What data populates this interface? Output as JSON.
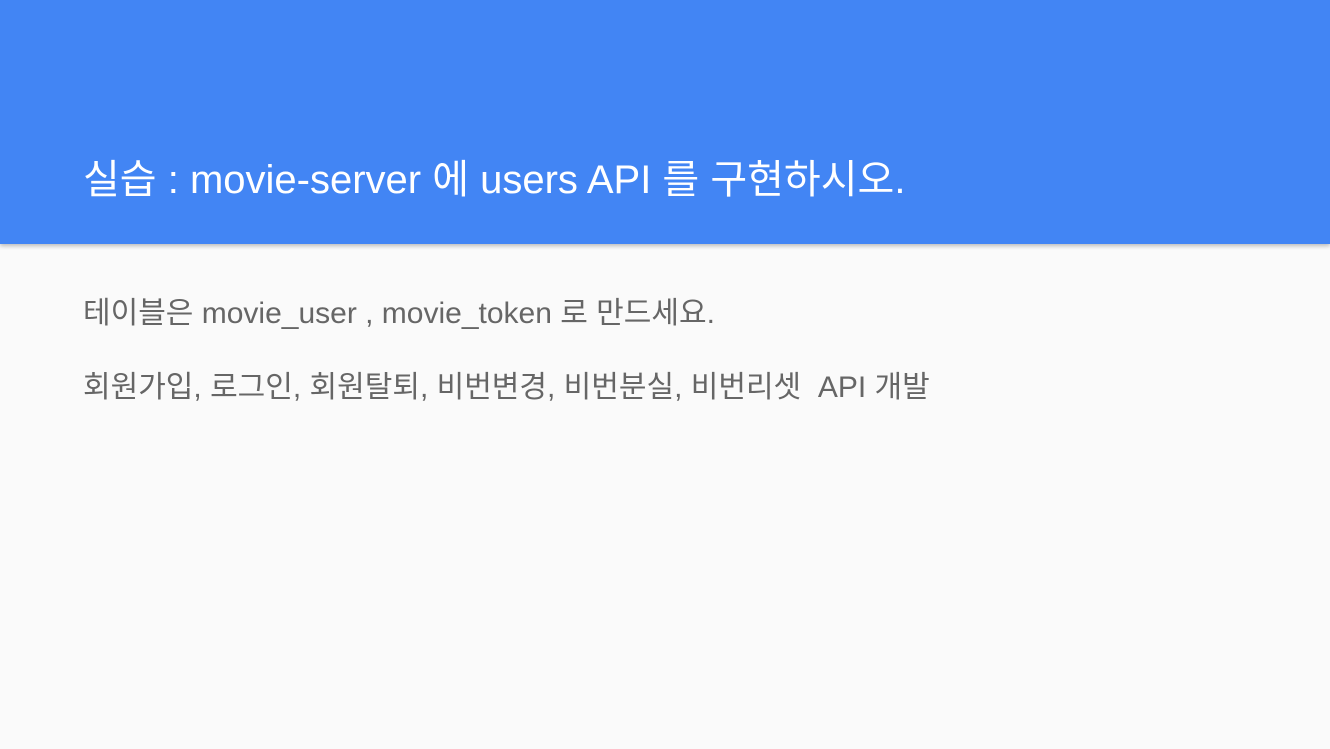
{
  "slide": {
    "title": "실습 : movie-server 에 users API 를 구현하시오.",
    "lines": [
      "테이블은 movie_user , movie_token 로 만드세요.",
      "회원가입, 로그인, 회원탈퇴, 비번변경, 비번분실, 비번리셋  API 개발"
    ]
  },
  "colors": {
    "header": "#4285f4",
    "background": "#fafafa",
    "body_text": "#666666",
    "title_text": "#ffffff"
  }
}
